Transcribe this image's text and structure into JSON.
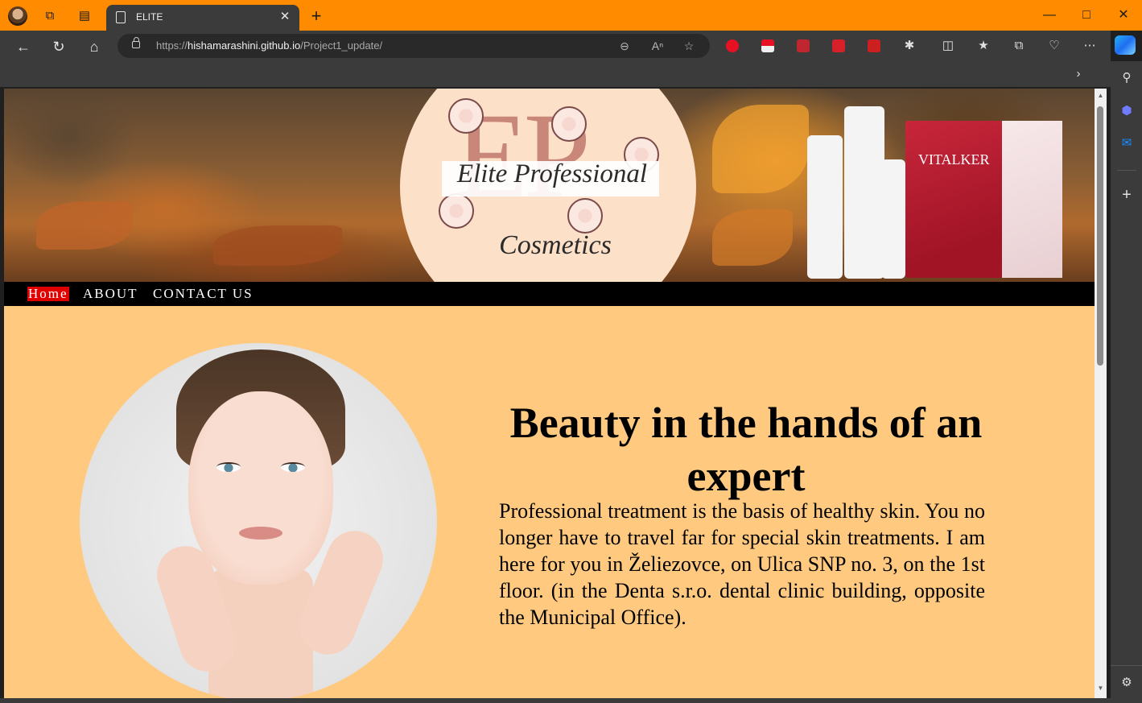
{
  "browser": {
    "tab_title": "ELITE",
    "url_scheme": "https://",
    "url_host": "hishamarashini.github.io",
    "url_path": "/Project1_update/",
    "frame_color": "#ff8c00",
    "toolbar_color": "#3b3b3b"
  },
  "icons": {
    "titlebar": [
      "profile-avatar",
      "workspaces-icon",
      "tab-actions-icon",
      "page-icon",
      "close-icon",
      "new-tab-icon",
      "minimize-icon",
      "maximize-icon",
      "window-close-icon"
    ],
    "toolbar": [
      "back-icon",
      "refresh-icon",
      "home-icon",
      "lock-icon",
      "zoom-out-icon",
      "read-aloud-icon",
      "favorite-star-icon",
      "extensions-icon",
      "split-screen-icon",
      "favorites-icon",
      "collections-icon",
      "browser-essentials-icon",
      "more-icon",
      "copilot-icon"
    ],
    "sidebar": [
      "search-icon",
      "copilot-sidebar-icon",
      "outlook-icon",
      "add-icon",
      "settings-icon"
    ]
  },
  "site": {
    "logo": {
      "monogram": "EP",
      "name": "Elite Professional",
      "subtitle": "Cosmetics"
    },
    "product_box_label": "VITALKER",
    "nav": [
      {
        "label": "Home",
        "active": true
      },
      {
        "label": "ABOUT",
        "active": false
      },
      {
        "label": "CONTACT US",
        "active": false
      }
    ],
    "hero": {
      "title": "Beauty in the hands of an expert",
      "text": "Professional treatment is the basis of healthy skin. You no longer have to travel far for special skin treatments. I am here for you in Želiezovce, on Ulica SNP no. 3, on the 1st floor. (in the Denta s.r.o. dental clinic building, opposite the Municipal Office)."
    },
    "colors": {
      "page_background": "#ffca80",
      "nav_background": "#000000",
      "nav_active": "#e00000",
      "logo_circle": "#fde0c8"
    }
  }
}
